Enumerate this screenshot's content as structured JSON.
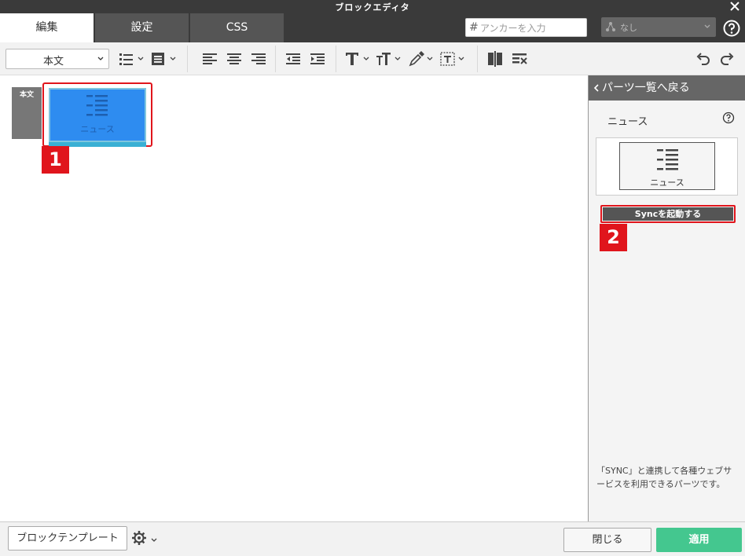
{
  "window": {
    "title": "ブロックエディタ",
    "close_icon": "close-icon"
  },
  "tabs": [
    {
      "label": "編集",
      "active": true
    },
    {
      "label": "設定",
      "active": false
    },
    {
      "label": "CSS",
      "active": false
    }
  ],
  "anchor": {
    "hash": "#",
    "placeholder": "アンカーを入力",
    "value": ""
  },
  "class_select": {
    "value": "なし"
  },
  "toolbar": {
    "style_select": "本文",
    "icons": [
      "list-icon",
      "block-format-icon",
      "align-left-icon",
      "align-center-icon",
      "align-right-icon",
      "outdent-icon",
      "indent-icon",
      "text-icon",
      "text-size-icon",
      "color-picker-icon",
      "text-border-icon",
      "column-icon",
      "clear-format-icon",
      "undo-icon",
      "redo-icon"
    ]
  },
  "canvas": {
    "body_label": "本文",
    "news_block_label": "ニュース",
    "markers": [
      "1",
      "2"
    ]
  },
  "panel": {
    "back_label": "パーツ一覧へ戻る",
    "part_name": "ニュース",
    "preview_label": "ニュース",
    "sync_button": "Syncを起動する",
    "description": "「SYNC」と連携して各種ウェブサービスを利用できるパーツです。"
  },
  "footer": {
    "template_button": "ブロックテンプレート",
    "close_button": "閉じる",
    "apply_button": "適用"
  },
  "colors": {
    "accent_red": "#e0151c",
    "apply_green": "#44c78f",
    "block_blue": "#2e8cf0"
  }
}
